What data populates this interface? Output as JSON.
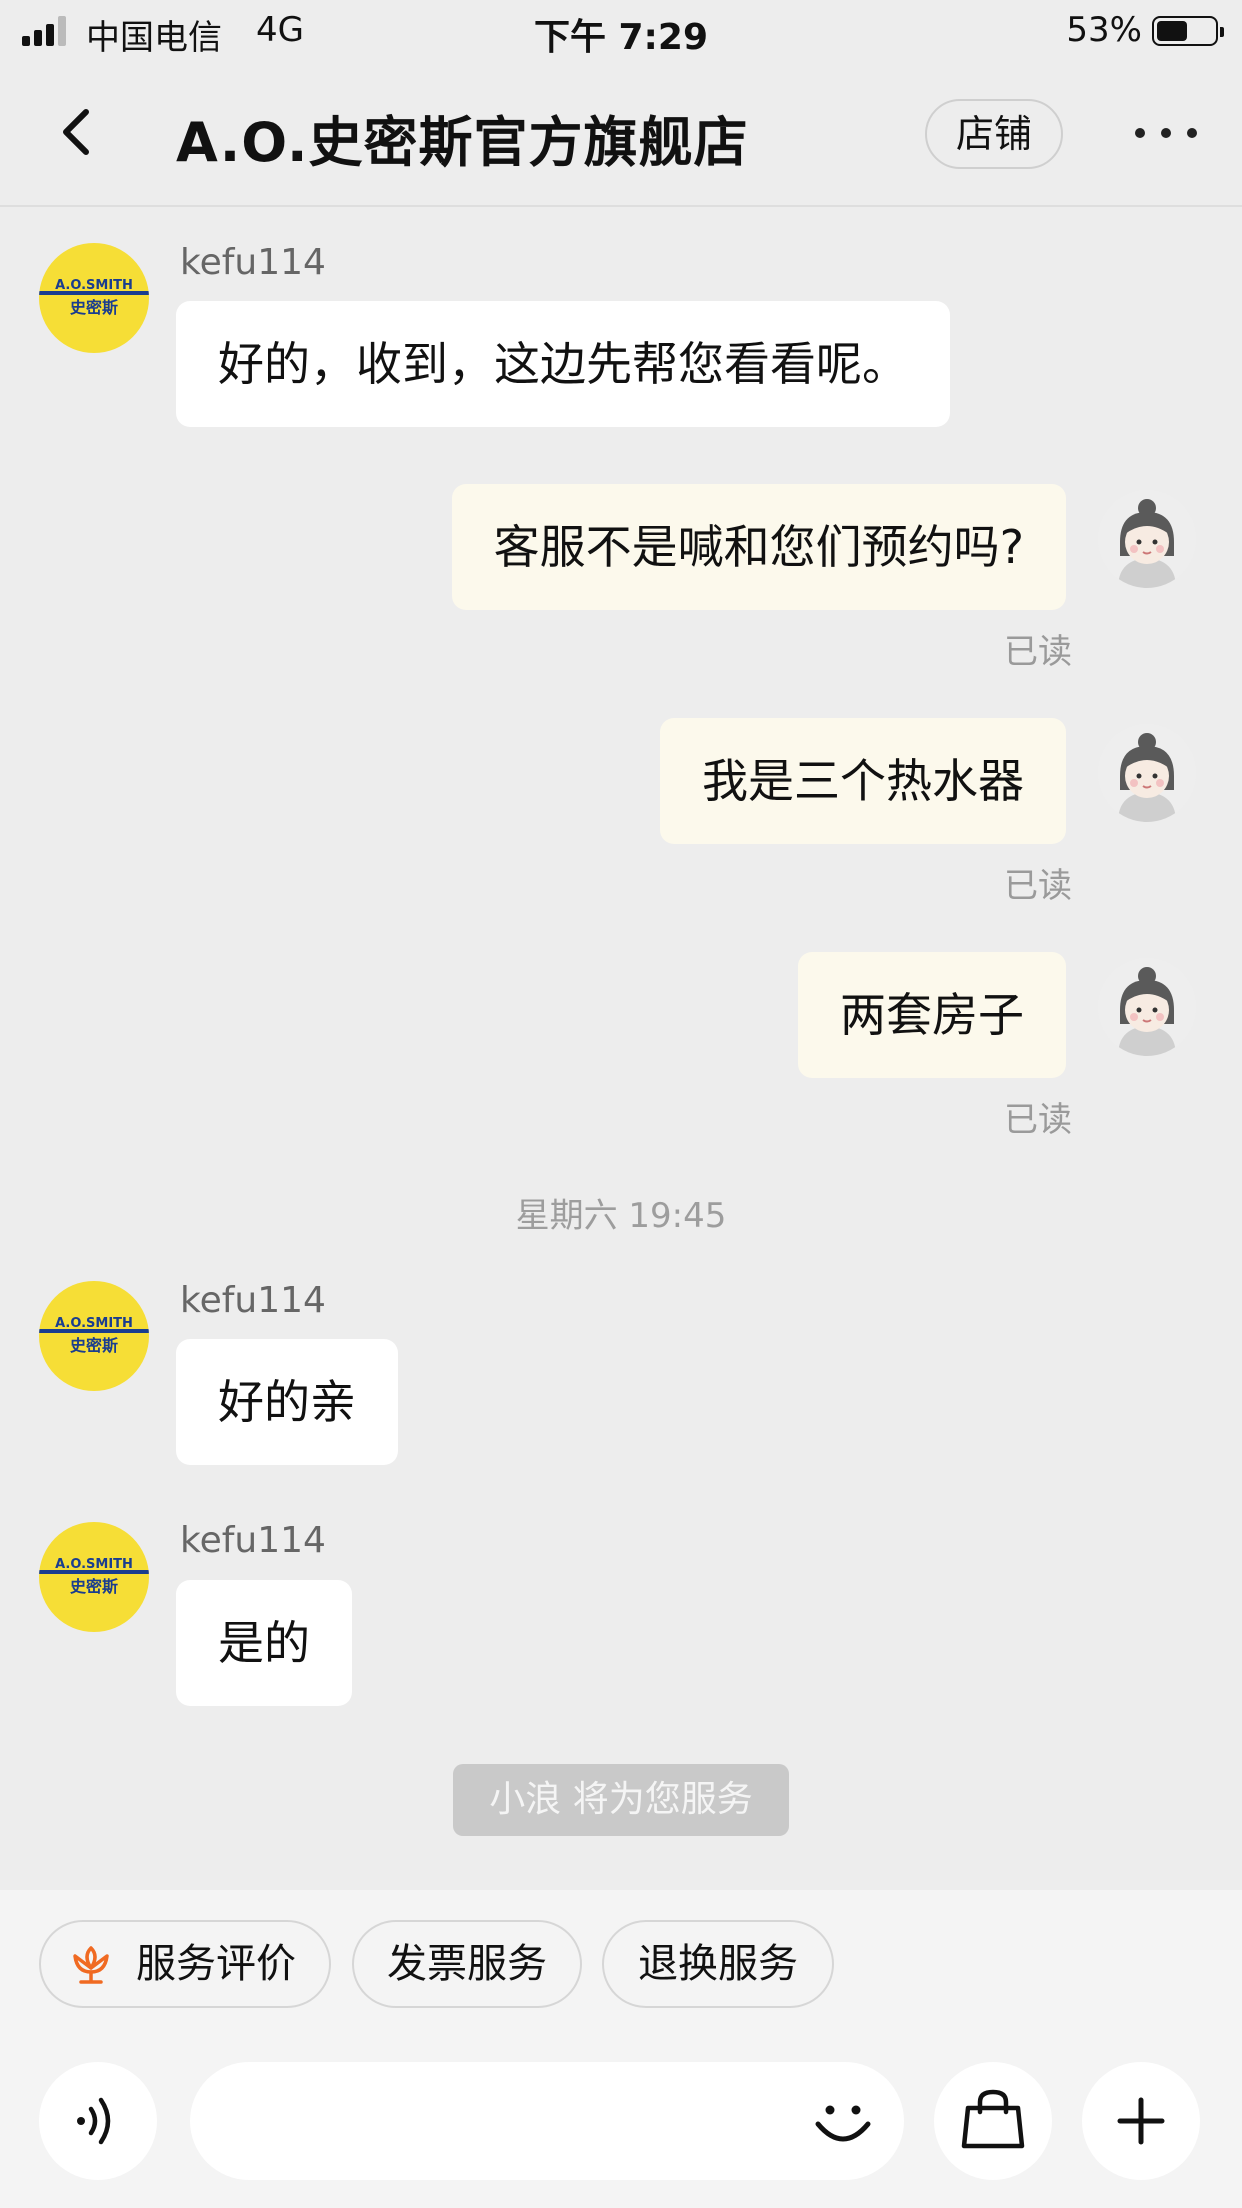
{
  "status_bar": {
    "carrier": "中国电信",
    "network": "4G",
    "time": "下午 7:29",
    "battery": "53%",
    "battery_level": 0.53
  },
  "header": {
    "title": "A.O.史密斯官方旗舰店",
    "shop_button": "店铺",
    "back_icon": "chevron-left-icon",
    "more_icon": "more-dots-icon"
  },
  "shop_logo_text": {
    "line1": "A.O.SMITH",
    "line2": "史密斯"
  },
  "messages": [
    {
      "from": "shop",
      "sender": "kefu114",
      "text": "好的，收到，这边先帮您看看呢。"
    },
    {
      "from": "user",
      "text": "客服不是喊和您们预约吗?",
      "status": "已读"
    },
    {
      "from": "user",
      "text": "我是三个热水器",
      "status": "已读"
    },
    {
      "from": "user",
      "text": "两套房子",
      "status": "已读"
    },
    {
      "from": "shop",
      "sender": "kefu114",
      "text": "好的亲"
    },
    {
      "from": "shop",
      "sender": "kefu114",
      "text": "是的"
    }
  ],
  "timestamp": "星期六 19:45",
  "system_notice": "小浪 将为您服务",
  "quick_actions": [
    {
      "label": "服务评价",
      "icon": "flower-rating-icon"
    },
    {
      "label": "发票服务"
    },
    {
      "label": "退换服务"
    }
  ],
  "input_bar": {
    "voice_icon": "voice-icon",
    "emoji_icon": "smile-icon",
    "product_icon": "shopping-bag-icon",
    "plus_icon": "plus-icon"
  },
  "colors": {
    "background": "#ededed",
    "incoming_bubble": "#ffffff",
    "outgoing_bubble": "#fcf9ec",
    "shop_avatar": "#f6de36",
    "accent": "#f06a22"
  }
}
